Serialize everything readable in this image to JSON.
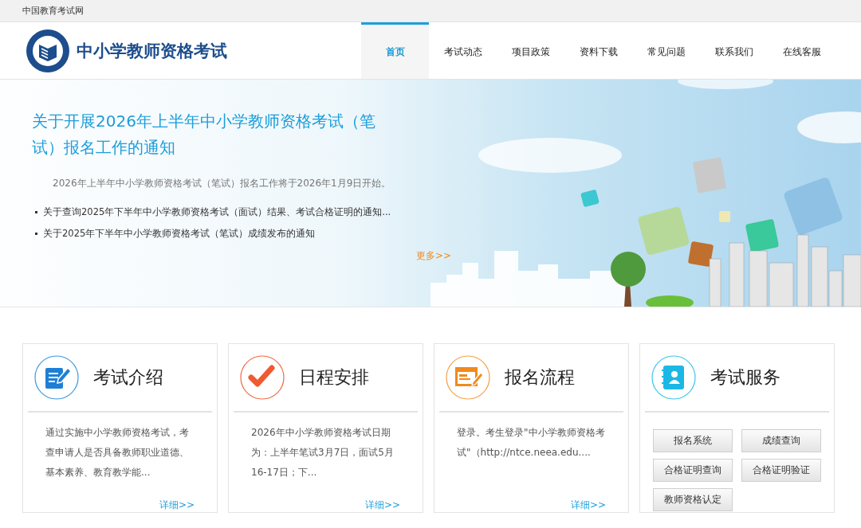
{
  "top_bar": {
    "site_link": "中国教育考试网"
  },
  "header": {
    "title": "中小学教师资格考试"
  },
  "nav": [
    {
      "label": "首页",
      "selected": true
    },
    {
      "label": "考试动态",
      "selected": false
    },
    {
      "label": "项目政策",
      "selected": false
    },
    {
      "label": "资料下载",
      "selected": false
    },
    {
      "label": "常见问题",
      "selected": false
    },
    {
      "label": "联系我们",
      "selected": false
    },
    {
      "label": "在线客服",
      "selected": false
    }
  ],
  "banner": {
    "headline": "关于开展2026年上半年中小学教师资格考试（笔试）报名工作的通知",
    "summary": "2026年上半年中小学教师资格考试（笔试）报名工作将于2026年1月9日开始。",
    "news": [
      "关于查询2025年下半年中小学教师资格考试（面试）结果、考试合格证明的通知...",
      "关于2025年下半年中小学教师资格考试（笔试）成绩发布的通知"
    ],
    "more": "更多>>"
  },
  "cards": [
    {
      "kind": "intro",
      "title": "考试介绍",
      "text": "通过实施中小学教师资格考试，考查申请人是否具备教师职业道德、基本素养、教育教学能...",
      "more": "详细>>"
    },
    {
      "kind": "schedule",
      "title": "日程安排",
      "text": "2026年中小学教师资格考试日期为：上半年笔试3月7日，面试5月16-17日；下...",
      "more": "详细>>"
    },
    {
      "kind": "process",
      "title": "报名流程",
      "text": "登录。考生登录\"中小学教师资格考试\"（http://ntce.neea.edu....",
      "more": "详细>>"
    },
    {
      "kind": "services",
      "title": "考试服务",
      "buttons": [
        "报名系统",
        "成绩查询",
        "合格证明查询",
        "合格证明验证",
        "教师资格认定"
      ]
    }
  ]
}
